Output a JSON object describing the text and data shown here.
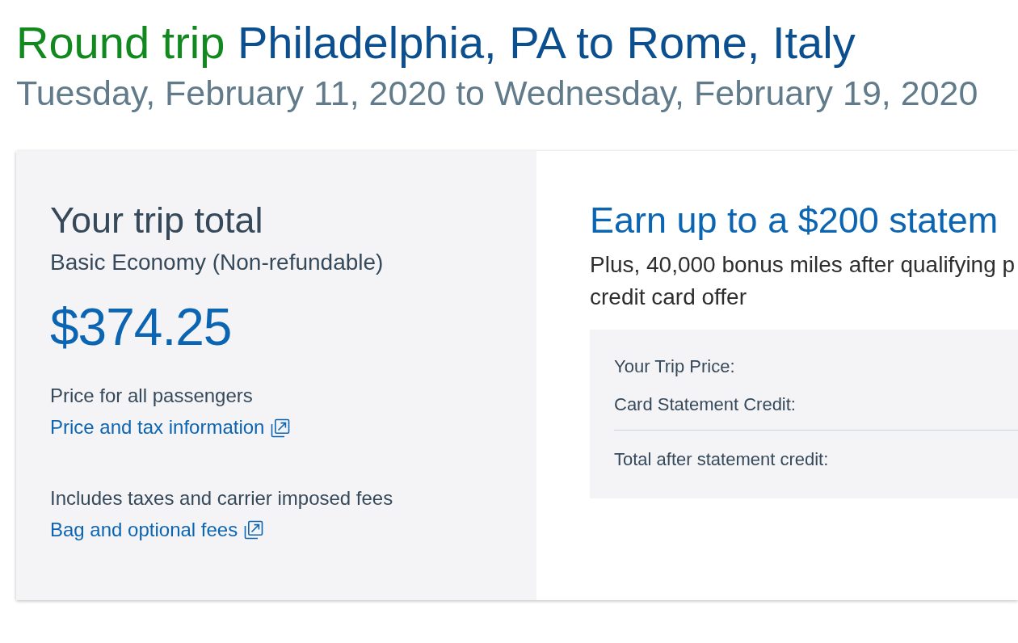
{
  "heading": {
    "prefix": "Round trip",
    "route": "Philadelphia, PA to Rome, Italy"
  },
  "dates": "Tuesday, February 11, 2020 to Wednesday, February 19, 2020",
  "trip_total": {
    "title": "Your trip total",
    "fare_type": "Basic Economy (Non-refundable)",
    "price": "$374.25",
    "notes": [
      {
        "text": "Price for all passengers",
        "link": "Price and tax information"
      },
      {
        "text": "Includes taxes and carrier imposed fees",
        "link": "Bag and optional fees"
      }
    ]
  },
  "offer": {
    "title": "Earn up to a $200 statem",
    "description_lines": [
      "Plus, 40,000 bonus miles after qualifying p",
      "credit card offer"
    ],
    "summary_rows": [
      {
        "kind": "item",
        "label": "Your Trip Price:"
      },
      {
        "kind": "item",
        "label": "Card Statement Credit:"
      },
      {
        "kind": "total",
        "label": "Total after statement credit:"
      }
    ]
  }
}
